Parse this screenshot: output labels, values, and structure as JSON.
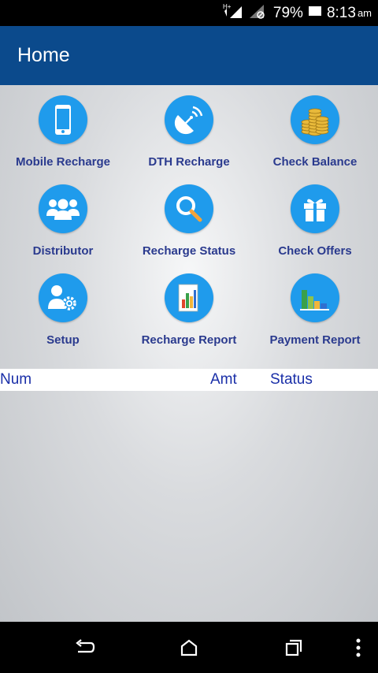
{
  "status_bar": {
    "network_label": "H+",
    "battery": "79%",
    "time": "8:13",
    "ampm": "am"
  },
  "app_bar": {
    "title": "Home"
  },
  "menu": [
    {
      "label": "Mobile Recharge",
      "icon": "mobile-phone-icon"
    },
    {
      "label": "DTH Recharge",
      "icon": "satellite-dish-icon"
    },
    {
      "label": "Check Balance",
      "icon": "coins-icon"
    },
    {
      "label": "Distributor",
      "icon": "users-icon"
    },
    {
      "label": "Recharge Status",
      "icon": "magnifier-icon"
    },
    {
      "label": "Check Offers",
      "icon": "gift-icon"
    },
    {
      "label": "Setup",
      "icon": "user-settings-icon"
    },
    {
      "label": "Recharge Report",
      "icon": "bar-report-icon"
    },
    {
      "label": "Payment Report",
      "icon": "payment-chart-icon"
    }
  ],
  "table": {
    "headers": [
      "Num",
      "Amt",
      "Status"
    ]
  },
  "colors": {
    "app_bar": "#0b4a8c",
    "icon_circle": "#1f9bec",
    "label_text": "#2a3a8e",
    "header_text": "#1a2fa8"
  }
}
